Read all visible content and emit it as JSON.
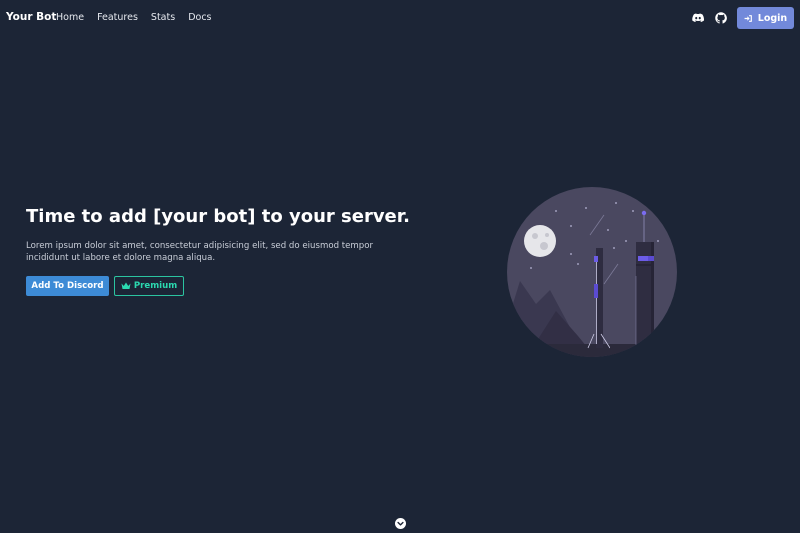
{
  "nav": {
    "brand": "Your Bot",
    "links": [
      "Home",
      "Features",
      "Stats",
      "Docs"
    ],
    "icons": [
      "discord-icon",
      "github-icon"
    ],
    "login_label": "Login"
  },
  "hero": {
    "title": "Time to add [your bot] to your server.",
    "subtitle": "Lorem ipsum dolor sit amet, consectetur adipisicing elit, sed do eiusmod tempor incididunt ut labore et dolore magna aliqua.",
    "add_button": "Add To Discord",
    "premium_button": "Premium"
  },
  "colors": {
    "background": "#1c2536",
    "login": "#7289da",
    "add": "#3d8bd6",
    "premium": "#2bd9b0",
    "illustration_circle": "#4a4860"
  }
}
